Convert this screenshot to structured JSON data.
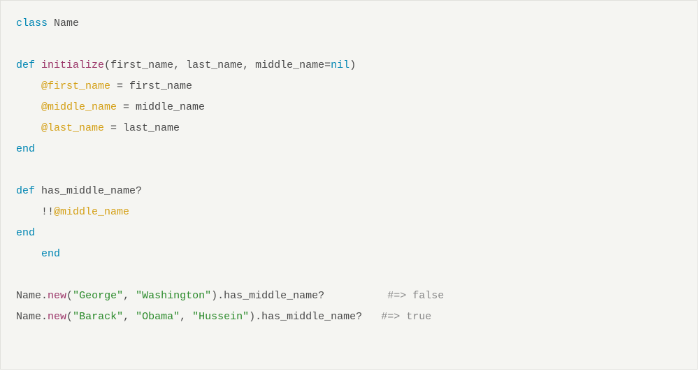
{
  "code": {
    "l1": {
      "kw_class": "class",
      "cname": "Name"
    },
    "l3": {
      "kw_def": "def",
      "method": "initialize",
      "lp": "(",
      "p1": "first_name",
      "c1": ", ",
      "p2": "last_name",
      "c2": ", ",
      "p3": "middle_name",
      "eq": "=",
      "nil": "nil",
      "rp": ")"
    },
    "l4": {
      "ivar": "@first_name",
      "eq": " = ",
      "val": "first_name"
    },
    "l5": {
      "ivar": "@middle_name",
      "eq": " = ",
      "val": "middle_name"
    },
    "l6": {
      "ivar": "@last_name",
      "eq": " = ",
      "val": "last_name"
    },
    "l7": {
      "kw_end": "end"
    },
    "l9": {
      "kw_def": "def",
      "method": "has_middle_name?"
    },
    "l10": {
      "bang": "!!",
      "ivar": "@middle_name"
    },
    "l11": {
      "kw_end": "end"
    },
    "l12": {
      "kw_end": "end"
    },
    "l14": {
      "cname": "Name",
      "dot1": ".",
      "new": "new",
      "lp": "(",
      "s1": "\"George\"",
      "c1": ", ",
      "s2": "\"Washington\"",
      "rp": ").",
      "call": "has_middle_name?",
      "pad": "          ",
      "comment": "#=> false"
    },
    "l15": {
      "cname": "Name",
      "dot1": ".",
      "new": "new",
      "lp": "(",
      "s1": "\"Barack\"",
      "c1": ", ",
      "s2": "\"Obama\"",
      "c2": ", ",
      "s3": "\"Hussein\"",
      "rp": ").",
      "call": "has_middle_name?",
      "pad": "   ",
      "comment": "#=> true"
    }
  }
}
